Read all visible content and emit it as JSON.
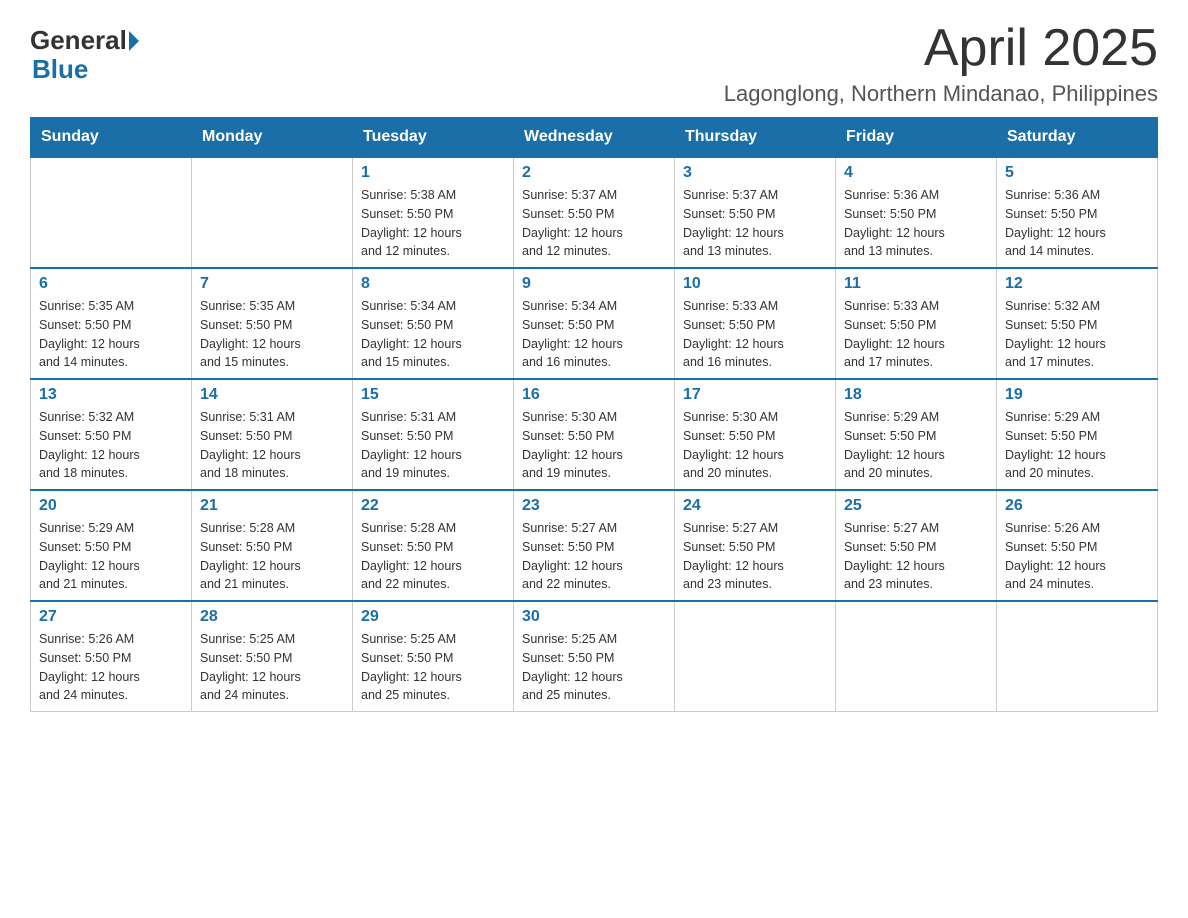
{
  "header": {
    "logo": {
      "general": "General",
      "blue": "Blue"
    },
    "title": "April 2025",
    "location": "Lagonglong, Northern Mindanao, Philippines"
  },
  "days_of_week": [
    "Sunday",
    "Monday",
    "Tuesday",
    "Wednesday",
    "Thursday",
    "Friday",
    "Saturday"
  ],
  "weeks": [
    [
      {
        "day": "",
        "info": ""
      },
      {
        "day": "",
        "info": ""
      },
      {
        "day": "1",
        "info": "Sunrise: 5:38 AM\nSunset: 5:50 PM\nDaylight: 12 hours\nand 12 minutes."
      },
      {
        "day": "2",
        "info": "Sunrise: 5:37 AM\nSunset: 5:50 PM\nDaylight: 12 hours\nand 12 minutes."
      },
      {
        "day": "3",
        "info": "Sunrise: 5:37 AM\nSunset: 5:50 PM\nDaylight: 12 hours\nand 13 minutes."
      },
      {
        "day": "4",
        "info": "Sunrise: 5:36 AM\nSunset: 5:50 PM\nDaylight: 12 hours\nand 13 minutes."
      },
      {
        "day": "5",
        "info": "Sunrise: 5:36 AM\nSunset: 5:50 PM\nDaylight: 12 hours\nand 14 minutes."
      }
    ],
    [
      {
        "day": "6",
        "info": "Sunrise: 5:35 AM\nSunset: 5:50 PM\nDaylight: 12 hours\nand 14 minutes."
      },
      {
        "day": "7",
        "info": "Sunrise: 5:35 AM\nSunset: 5:50 PM\nDaylight: 12 hours\nand 15 minutes."
      },
      {
        "day": "8",
        "info": "Sunrise: 5:34 AM\nSunset: 5:50 PM\nDaylight: 12 hours\nand 15 minutes."
      },
      {
        "day": "9",
        "info": "Sunrise: 5:34 AM\nSunset: 5:50 PM\nDaylight: 12 hours\nand 16 minutes."
      },
      {
        "day": "10",
        "info": "Sunrise: 5:33 AM\nSunset: 5:50 PM\nDaylight: 12 hours\nand 16 minutes."
      },
      {
        "day": "11",
        "info": "Sunrise: 5:33 AM\nSunset: 5:50 PM\nDaylight: 12 hours\nand 17 minutes."
      },
      {
        "day": "12",
        "info": "Sunrise: 5:32 AM\nSunset: 5:50 PM\nDaylight: 12 hours\nand 17 minutes."
      }
    ],
    [
      {
        "day": "13",
        "info": "Sunrise: 5:32 AM\nSunset: 5:50 PM\nDaylight: 12 hours\nand 18 minutes."
      },
      {
        "day": "14",
        "info": "Sunrise: 5:31 AM\nSunset: 5:50 PM\nDaylight: 12 hours\nand 18 minutes."
      },
      {
        "day": "15",
        "info": "Sunrise: 5:31 AM\nSunset: 5:50 PM\nDaylight: 12 hours\nand 19 minutes."
      },
      {
        "day": "16",
        "info": "Sunrise: 5:30 AM\nSunset: 5:50 PM\nDaylight: 12 hours\nand 19 minutes."
      },
      {
        "day": "17",
        "info": "Sunrise: 5:30 AM\nSunset: 5:50 PM\nDaylight: 12 hours\nand 20 minutes."
      },
      {
        "day": "18",
        "info": "Sunrise: 5:29 AM\nSunset: 5:50 PM\nDaylight: 12 hours\nand 20 minutes."
      },
      {
        "day": "19",
        "info": "Sunrise: 5:29 AM\nSunset: 5:50 PM\nDaylight: 12 hours\nand 20 minutes."
      }
    ],
    [
      {
        "day": "20",
        "info": "Sunrise: 5:29 AM\nSunset: 5:50 PM\nDaylight: 12 hours\nand 21 minutes."
      },
      {
        "day": "21",
        "info": "Sunrise: 5:28 AM\nSunset: 5:50 PM\nDaylight: 12 hours\nand 21 minutes."
      },
      {
        "day": "22",
        "info": "Sunrise: 5:28 AM\nSunset: 5:50 PM\nDaylight: 12 hours\nand 22 minutes."
      },
      {
        "day": "23",
        "info": "Sunrise: 5:27 AM\nSunset: 5:50 PM\nDaylight: 12 hours\nand 22 minutes."
      },
      {
        "day": "24",
        "info": "Sunrise: 5:27 AM\nSunset: 5:50 PM\nDaylight: 12 hours\nand 23 minutes."
      },
      {
        "day": "25",
        "info": "Sunrise: 5:27 AM\nSunset: 5:50 PM\nDaylight: 12 hours\nand 23 minutes."
      },
      {
        "day": "26",
        "info": "Sunrise: 5:26 AM\nSunset: 5:50 PM\nDaylight: 12 hours\nand 24 minutes."
      }
    ],
    [
      {
        "day": "27",
        "info": "Sunrise: 5:26 AM\nSunset: 5:50 PM\nDaylight: 12 hours\nand 24 minutes."
      },
      {
        "day": "28",
        "info": "Sunrise: 5:25 AM\nSunset: 5:50 PM\nDaylight: 12 hours\nand 24 minutes."
      },
      {
        "day": "29",
        "info": "Sunrise: 5:25 AM\nSunset: 5:50 PM\nDaylight: 12 hours\nand 25 minutes."
      },
      {
        "day": "30",
        "info": "Sunrise: 5:25 AM\nSunset: 5:50 PM\nDaylight: 12 hours\nand 25 minutes."
      },
      {
        "day": "",
        "info": ""
      },
      {
        "day": "",
        "info": ""
      },
      {
        "day": "",
        "info": ""
      }
    ]
  ]
}
